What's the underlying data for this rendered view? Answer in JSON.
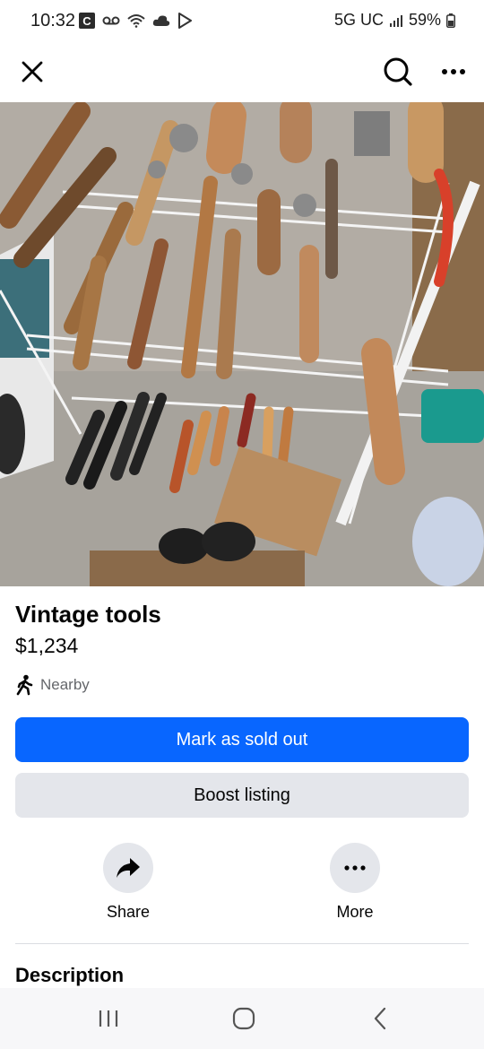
{
  "status_bar": {
    "time": "10:32",
    "network": "5G UC",
    "battery": "59%",
    "icons": [
      "c-app-icon",
      "voicemail-icon",
      "wifi-icon",
      "cloud-icon",
      "play-store-icon",
      "signal-icon",
      "battery-icon"
    ]
  },
  "top_bar": {
    "icons": [
      "close-icon",
      "search-icon",
      "more-horizontal-icon"
    ]
  },
  "listing": {
    "title": "Vintage tools",
    "price": "$1,234",
    "location": "Nearby",
    "location_icon": "walking-person-icon"
  },
  "buttons": {
    "primary": "Mark as sold out",
    "secondary": "Boost listing",
    "primary_color": "#0866ff",
    "secondary_color": "#e4e6eb"
  },
  "actions": [
    {
      "label": "Share",
      "icon": "share-arrow-icon"
    },
    {
      "label": "More",
      "icon": "more-horizontal-icon"
    }
  ],
  "description": {
    "heading": "Description"
  },
  "nav_bar": {
    "icons": [
      "recent-apps-icon",
      "home-icon",
      "back-icon"
    ]
  }
}
